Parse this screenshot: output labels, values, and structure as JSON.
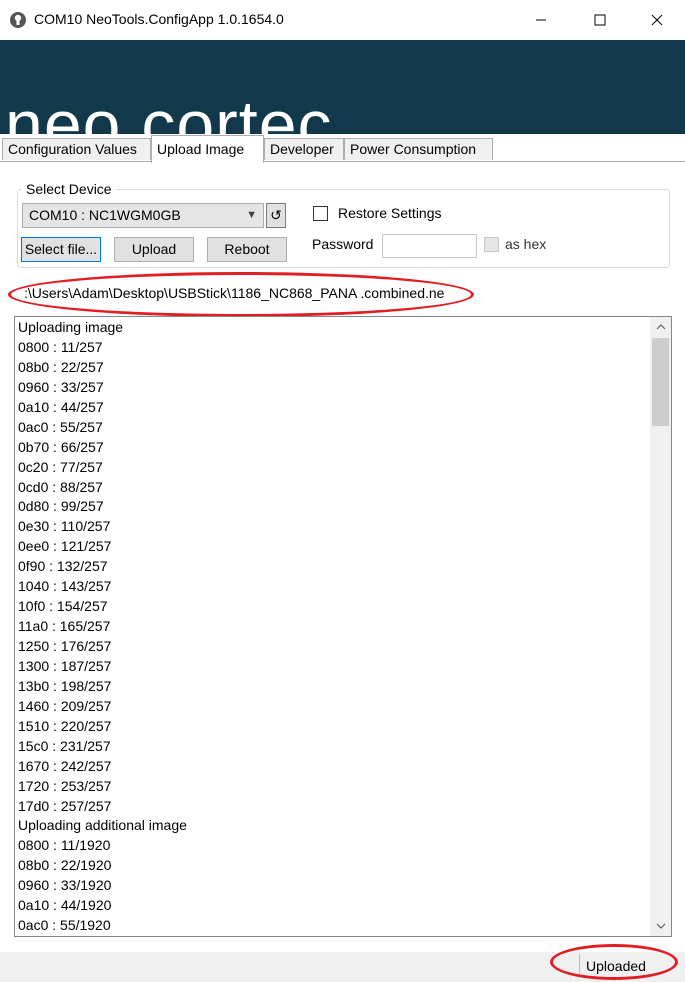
{
  "window": {
    "title": "COM10 NeoTools.ConfigApp 1.0.1654.0",
    "icon": "app-icon",
    "controls": [
      "minimize-icon",
      "maximize-icon",
      "close-icon"
    ]
  },
  "banner": {
    "logo_text": "neo.cortec",
    "background": "#12394b"
  },
  "tabs": [
    {
      "label": "Configuration Values",
      "active": false
    },
    {
      "label": "Upload Image",
      "active": true
    },
    {
      "label": "Developer",
      "active": false
    },
    {
      "label": "Power Consumption",
      "active": false
    }
  ],
  "select_device": {
    "group_label": "Select Device",
    "device": "COM10 : NC1WGM0GB",
    "refresh_label": "↺",
    "buttons": {
      "select_file": "Select file...",
      "upload": "Upload",
      "reboot": "Reboot"
    },
    "restore_settings_label": "Restore Settings",
    "restore_settings_checked": false,
    "password_label": "Password",
    "password_value": "",
    "as_hex_label": "as hex",
    "as_hex_checked": false
  },
  "file_path": ":\\Users\\Adam\\Desktop\\USBStick\\1186_NC868_PANA .combined.ne",
  "log": [
    "Uploading image",
    "0800 : 11/257",
    "08b0 : 22/257",
    "0960 : 33/257",
    "0a10 : 44/257",
    "0ac0 : 55/257",
    "0b70 : 66/257",
    "0c20 : 77/257",
    "0cd0 : 88/257",
    "0d80 : 99/257",
    "0e30 : 110/257",
    "0ee0 : 121/257",
    "0f90 : 132/257",
    "1040 : 143/257",
    "10f0 : 154/257",
    "11a0 : 165/257",
    "1250 : 176/257",
    "1300 : 187/257",
    "13b0 : 198/257",
    "1460 : 209/257",
    "1510 : 220/257",
    "15c0 : 231/257",
    "1670 : 242/257",
    "1720 : 253/257",
    "17d0 : 257/257",
    "Uploading additional image",
    "0800 : 11/1920",
    "08b0 : 22/1920",
    "0960 : 33/1920",
    "0a10 : 44/1920",
    "0ac0 : 55/1920"
  ],
  "status": {
    "text": "Uploaded"
  },
  "annotation_color": "#e01e24"
}
